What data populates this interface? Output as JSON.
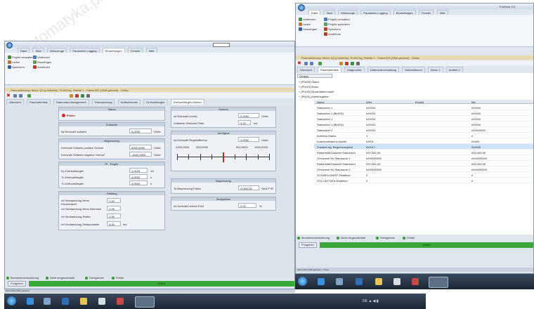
{
  "watermark": "rgbautomatyka.pl",
  "left": {
    "ribbon_tabs": [
      "Datei",
      "Start",
      "Werkzeuge",
      "Parameter-Logging",
      "Einstellungen",
      "Fenster",
      "Hilfe"
    ],
    "ribbon_items": [
      "Projekt verwalten",
      "Verbinden",
      "Laden",
      "Hinzufügen",
      "Speichern",
      "Ausführen"
    ],
    "doc_title": "Parametrierung: Motor 1(3 g Antriebe), Profil-Drg, Palette 1 - Pamer323 (XMA getunet) - Online",
    "tabs": [
      "Übersicht",
      "Parameterliste",
      "Datensatz-Management",
      "Überwachung",
      "Notfunktionen",
      "Drehzahlregler",
      "Drehzahlregler-Diktion"
    ],
    "status_hdr": "Status",
    "status_val": "Fehler",
    "soll_hdr": "Sollwerte",
    "soll_rows": [
      {
        "label": "Ist Drehzahl sollwert",
        "val": "0,0000",
        "unit": "U/min"
      }
    ],
    "reg_hdr": "Begrenzung",
    "reg_rows": [
      {
        "label": "Drehzahl Sollwert positive Grenze",
        "val": "3000,0000",
        "unit": "U/min"
      },
      {
        "label": "Drehzahl Sollwert negative Grenze",
        "val": "-3000,0000",
        "unit": "U/min"
      }
    ],
    "pi_hdr": "PI - Regler",
    "pi_rows": [
      {
        "label": "Kp Drehzahlregler",
        "val": "1,0120",
        "unit": "1/s"
      },
      {
        "label": "Tn Drehzahlregler",
        "val": "4,0000",
        "unit": "s"
      },
      {
        "label": "Tn Drehzahlregler",
        "val": "4,0000",
        "unit": "s"
      }
    ],
    "filt_hdr": "Glättung",
    "filt_rows": [
      {
        "label": "ref Verstaerkung Nenn Hochlaufzeit",
        "val": "1,00",
        "unit": ""
      },
      {
        "label": "ref Verstaerkung Nenn Bremsen",
        "val": "1,00",
        "unit": ""
      },
      {
        "label": "ref Verstaerkung Rollen",
        "val": "1,00",
        "unit": ""
      },
      {
        "label": "ref Verstaerkung Zeitkonstante",
        "val": "4,00",
        "unit": "ms"
      }
    ],
    "mon_hdr": "Summe",
    "mon_rows": [
      {
        "label": "ist Drehzahl (cmot)",
        "val": "0,0000",
        "unit": "U/min"
      },
      {
        "label": "Sollwerte Drehzahl Filter",
        "val": "0,00",
        "unit": "ms"
      }
    ],
    "ist_hdr": "Ist-Signal",
    "ist_rows": [
      {
        "label": "ist Drehzahl Regeldifferenz",
        "val": "0,0000",
        "unit": "U/min"
      }
    ],
    "scale_labels": [
      "-1000,0000",
      "-500,0000",
      "",
      "500,0000",
      "1000,0000"
    ],
    "lim_hdr": "Begrenzung",
    "lim_rows": [
      {
        "label": "Ta Begrenzung Faktor",
        "val": "47500,00",
        "unit": "Omit FTE"
      }
    ],
    "stab_hdr": "Stellgrößen",
    "stab_rows": [
      {
        "label": "Ist Drehzahl erhöht Feld",
        "val": "0,00",
        "unit": "%"
      }
    ],
    "legend": [
      "Momentenreduzierung",
      "Nicht eingeschränkt",
      "Drehgrenze",
      "Fehler"
    ],
    "stop_btn": "Freigeben",
    "online": "Online",
    "statusbar": "Pamer323 (XMA getunet)"
  },
  "right": {
    "app_title": "ProDrive 2.0",
    "ribbon_tabs": [
      "Datei",
      "Start",
      "Werkzeuge",
      "Parameter-Logging",
      "Einstellungen",
      "Fenster",
      "Hilfe"
    ],
    "ribbon_items": [
      "Verbinden",
      "Projekt verwalten",
      "Laden",
      "Projekt speichern",
      "Hinzufügen",
      "Speichern",
      "Ausführen"
    ],
    "doc_title": "Parametrierung: Motor 1(3 g Antriebe), Profil-Drg, Palette 1 - Pamer323 (XMA getunet) - Online",
    "tabs": [
      "Übersicht",
      "Parameterliste",
      "Diagnostics",
      "Datensatzverwaltung",
      "Notfunktionen",
      "Motor 1",
      "Antrieb 2"
    ],
    "filter": "Gruppe",
    "groups": [
      "[P0x00] Status",
      "[P0x10] Motor",
      "[P0x20] Motordatenmodell",
      "[P0x21] Antriebsgeber"
    ],
    "cols": [
      "Name",
      "Wert",
      "Einheit",
      "Min"
    ],
    "rows": [
      {
        "name": "Statuswort 1",
        "val": "0x0000",
        "unit": "",
        "min": "0x0000",
        "sel": false
      },
      {
        "name": "Statuswort 1 (BMOD)",
        "val": "0x0000",
        "unit": "",
        "min": "0x0000",
        "sel": false
      },
      {
        "name": "Statuswort 1",
        "val": "0x0000",
        "unit": "",
        "min": "0x0000",
        "sel": false
      },
      {
        "name": "Statuswort 1 (BMOD)",
        "val": "0x0000",
        "unit": "",
        "min": "0x0000",
        "sel": false
      },
      {
        "name": "Statuswort 2",
        "val": "0x0000",
        "unit": "",
        "min": "0x0000000",
        "sel": false
      },
      {
        "name": "Antriebs-Status",
        "val": "1",
        "unit": "",
        "min": "0",
        "sel": false
      },
      {
        "name": "Kommunikations-Quelle",
        "val": "0x001",
        "unit": "",
        "min": "0x000",
        "sel": false
      },
      {
        "name": "Zustand sig. Begrenzungsbit",
        "val": "0x0017",
        "unit": "",
        "min": "0x0000",
        "sel": true
      },
      {
        "name": "Rasterblatt/Zustand Statuswort",
        "val": "000.000.00",
        "unit": "",
        "min": "000.000.00",
        "sel": false
      },
      {
        "name": "Grenzwert für Statuswort 1",
        "val": "0x00000000",
        "unit": "",
        "min": "0x00000000",
        "sel": false
      },
      {
        "name": "Rasterblatt/Zustand Statuswort",
        "val": "000.000.00",
        "unit": "",
        "min": "000.000.00",
        "sel": false
      },
      {
        "name": "Grenzwert für Statuswort 2",
        "val": "0x00000000",
        "unit": "",
        "min": "0x00000000",
        "sel": false
      },
      {
        "name": "SCHWELLWERT-Reaktion",
        "val": "0",
        "unit": "",
        "min": "0",
        "sel": false
      },
      {
        "name": "STILLSETZEN-Reaktion",
        "val": "0",
        "unit": "",
        "min": "0",
        "sel": false
      }
    ],
    "legend": [
      "Momentenreduzierung",
      "Nicht eingeschränkt",
      "Drehgrenze",
      "Fehler"
    ],
    "stop_btn": "Freigeben",
    "online": "Online",
    "statusbar": "Pamer323 (XMA getunet) - Online"
  },
  "taskbar_right": "DE ▲ ◀ ▮"
}
